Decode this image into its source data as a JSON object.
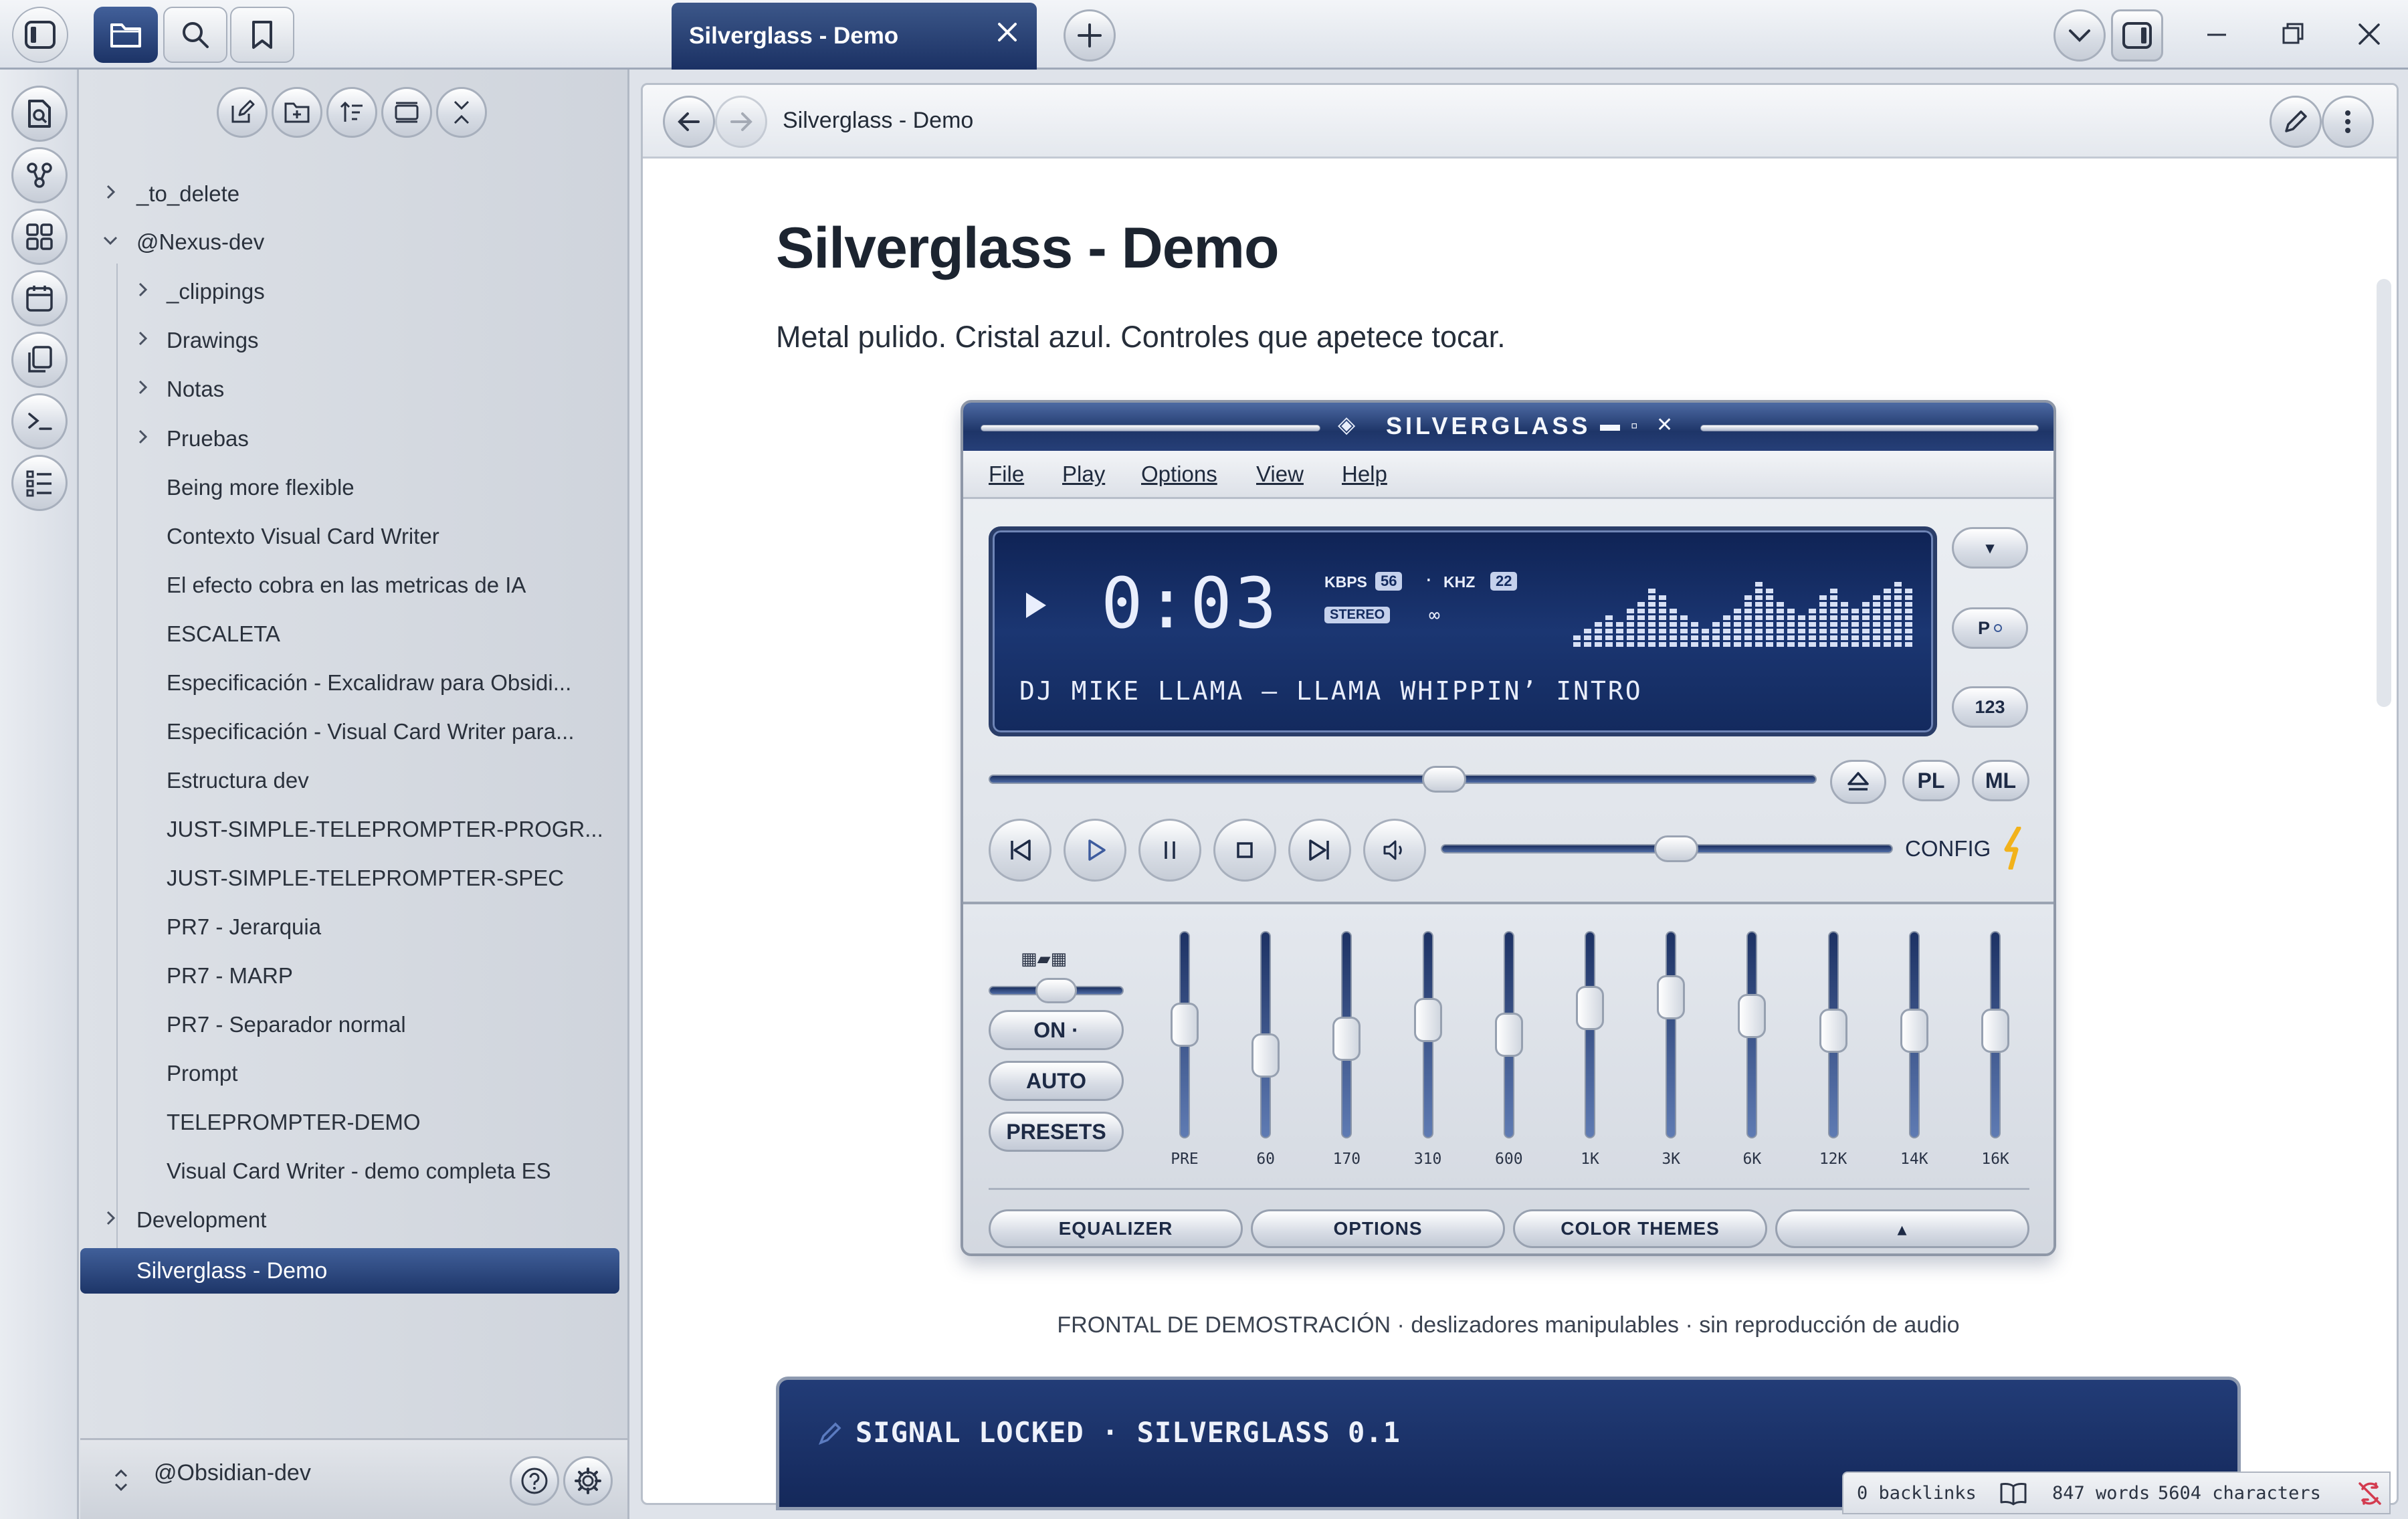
{
  "titlebar": {
    "tab_title": "Silverglass - Demo"
  },
  "sidebar": {
    "items": [
      {
        "label": "_to_delete"
      },
      {
        "label": "@Nexus-dev"
      },
      {
        "label": "_clippings"
      },
      {
        "label": "Drawings"
      },
      {
        "label": "Notas"
      },
      {
        "label": "Pruebas"
      },
      {
        "label": "Being more flexible"
      },
      {
        "label": "Contexto Visual Card Writer"
      },
      {
        "label": "El efecto cobra en las metricas de IA"
      },
      {
        "label": "ESCALETA"
      },
      {
        "label": "Especificación - Excalidraw para Obsidi..."
      },
      {
        "label": "Especificación - Visual Card Writer para..."
      },
      {
        "label": "Estructura dev"
      },
      {
        "label": "JUST-SIMPLE-TELEPROMPTER-PROGR..."
      },
      {
        "label": "JUST-SIMPLE-TELEPROMPTER-SPEC"
      },
      {
        "label": "PR7 - Jerarquia"
      },
      {
        "label": "PR7 - MARP"
      },
      {
        "label": "PR7 - Separador normal"
      },
      {
        "label": "Prompt"
      },
      {
        "label": "TELEPROMPTER-DEMO"
      },
      {
        "label": "Visual Card Writer - demo completa ES"
      },
      {
        "label": "Development"
      }
    ],
    "active_file": "Silverglass - Demo",
    "vault_name": "@Obsidian-dev"
  },
  "content": {
    "breadcrumb": "Silverglass - Demo",
    "title": "Silverglass - Demo",
    "subtitle": "Metal pulido. Cristal azul. Controles que apetece tocar.",
    "caption": "FRONTAL DE DEMOSTRACIÓN · deslizadores manipulables · sin reproducción de audio",
    "signal_text": "SIGNAL LOCKED · SILVERGLASS 0.1"
  },
  "player": {
    "title": "SILVERGLASS",
    "title_glyph": "◈",
    "window_controls": [
      "▬",
      "▫",
      "✕"
    ],
    "menu": [
      "File",
      "Play",
      "Options",
      "View",
      "Help"
    ],
    "time": "0:03",
    "kbps_label": "KBPS",
    "kbps": "56",
    "dot": "·",
    "khz_label": "KHZ",
    "khz": "22",
    "stereo": "STEREO",
    "loop_glyph": "∞",
    "track": "DJ MIKE LLAMA — LLAMA WHIPPIN’ INTRO",
    "side_buttons": [
      "▾",
      "P",
      "123"
    ],
    "seek_position": 0.55,
    "volume": 0.52,
    "right_buttons": [
      "PL",
      "ML"
    ],
    "config_label": "CONFIG",
    "eq_labels": [
      "PRE",
      "60",
      "170",
      "310",
      "600",
      "1K",
      "3K",
      "6K",
      "12K",
      "14K",
      "16K"
    ],
    "eq_values": [
      0.55,
      0.4,
      0.48,
      0.57,
      0.5,
      0.63,
      0.68,
      0.59,
      0.52,
      0.52,
      0.52
    ],
    "eq_buttons": [
      "ON ·",
      "AUTO",
      "PRESETS"
    ],
    "eq_mode_glyphs": "▦▰▦",
    "preamp": 0.5,
    "tabs": [
      "EQUALIZER",
      "OPTIONS",
      "COLOR THEMES",
      "▴"
    ],
    "spectrum": [
      2,
      3,
      4,
      5,
      4,
      6,
      7,
      9,
      8,
      6,
      5,
      4,
      3,
      4,
      5,
      6,
      8,
      10,
      9,
      7,
      6,
      5,
      6,
      8,
      9,
      7,
      6,
      7,
      8,
      9,
      10,
      9
    ]
  },
  "statusbar": {
    "backlinks": "0 backlinks",
    "words": "847 words",
    "characters": "5604 characters"
  },
  "colors": {
    "accent": "#1f3768",
    "accent_light": "#4a66a0",
    "lcd": "#14295c"
  }
}
